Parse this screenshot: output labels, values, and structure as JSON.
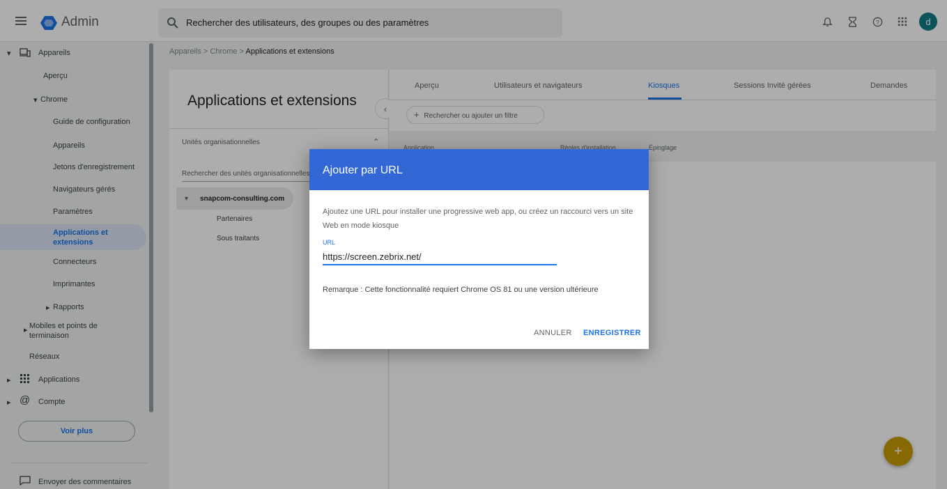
{
  "topbar": {
    "app_name": "Admin",
    "search_placeholder": "Rechercher des utilisateurs, des groupes ou des paramètres",
    "avatar_letter": "d"
  },
  "sidebar": {
    "items": [
      {
        "label": "Appareils"
      },
      {
        "label": "Aperçu"
      },
      {
        "label": "Chrome"
      },
      {
        "label": "Guide de configuration"
      },
      {
        "label": "Appareils"
      },
      {
        "label": "Jetons d'enregistrement"
      },
      {
        "label": "Navigateurs gérés"
      },
      {
        "label": "Paramètres"
      },
      {
        "label": "Applications et extensions"
      },
      {
        "label": "Connecteurs"
      },
      {
        "label": "Imprimantes"
      },
      {
        "label": "Rapports"
      },
      {
        "label": "Mobiles et points de terminaison"
      },
      {
        "label": "Réseaux"
      },
      {
        "label": "Applications"
      },
      {
        "label": "Compte"
      }
    ],
    "voir_plus": "Voir plus",
    "feedback": "Envoyer des commentaires"
  },
  "breadcrumb": {
    "part1": "Appareils",
    "part2": "Chrome",
    "current": "Applications et extensions",
    "sep": ">"
  },
  "ou_panel": {
    "title": "Applications et extensions",
    "section": "Unités organisationnelles",
    "search_placeholder": "Rechercher des unités organisationnelles",
    "root": "snapcom-consulting.com",
    "children": [
      "Partenaires",
      "Sous traitants"
    ]
  },
  "tabs": [
    {
      "label": "Aperçu"
    },
    {
      "label": "Utilisateurs et navigateurs"
    },
    {
      "label": "Kiosques"
    },
    {
      "label": "Sessions Invité gérées"
    },
    {
      "label": "Demandes"
    }
  ],
  "filter_label": "Rechercher ou ajouter un filtre",
  "table_headers": [
    "Application",
    "Règles d'installation",
    "Épinglage"
  ],
  "dialog": {
    "title": "Ajouter par URL",
    "description": "Ajoutez une URL pour installer une progressive web app, ou créez un raccourci vers un site Web en mode kiosque",
    "url_label": "URL",
    "url_value": "https://screen.zebrix.net/",
    "note": "Remarque : Cette fonctionnalité requiert Chrome OS 81 ou une version ultérieure",
    "cancel": "ANNULER",
    "save": "ENREGISTRER"
  },
  "colors": {
    "dialog_header": "#3367d6",
    "accent": "#1a73e8",
    "fab": "#c79b05"
  }
}
